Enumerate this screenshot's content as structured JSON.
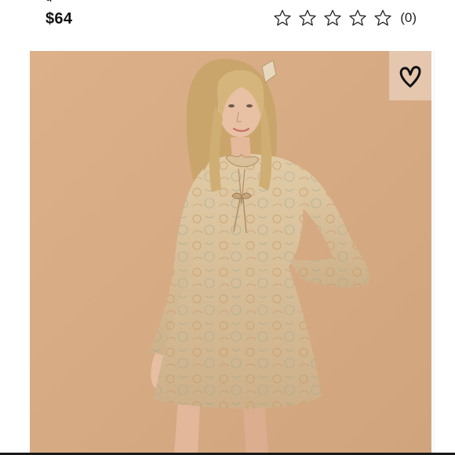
{
  "product": {
    "title_fragment": "g",
    "price": "$64",
    "review_count": "(0)"
  },
  "rating": {
    "stars_filled": 0,
    "stars_total": 5,
    "star_icon": "star-outline-icon"
  },
  "favorite": {
    "icon": "heart-outline-icon"
  },
  "colors": {
    "photo_background": "#d7ab82",
    "dress": "#d9c09a",
    "text": "#111111"
  }
}
